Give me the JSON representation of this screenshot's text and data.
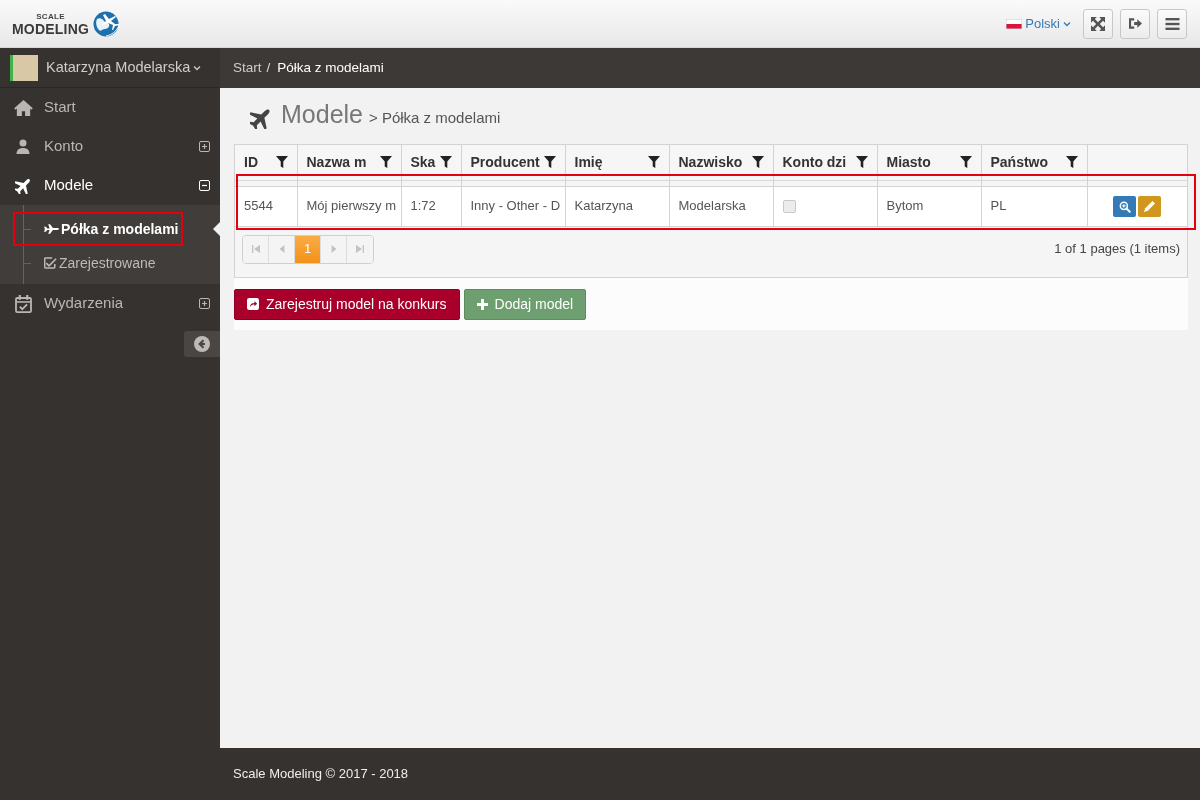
{
  "topbar": {
    "logo": {
      "small": "SCALE",
      "main": "MODELING"
    },
    "language": {
      "label": "Polski"
    },
    "buttons": [
      {
        "kind": "fullscreen"
      },
      {
        "kind": "logout"
      },
      {
        "kind": "menu"
      }
    ]
  },
  "sidebar": {
    "user": {
      "name": "Katarzyna Modelarska"
    },
    "items": [
      {
        "kind": "link",
        "label": "Start",
        "selected": false
      },
      {
        "kind": "group",
        "label": "Konto",
        "selected": false,
        "expanded": false
      },
      {
        "kind": "group",
        "label": "Modele",
        "selected": true,
        "expanded": true,
        "children": [
          {
            "label": "Półka z modelami",
            "selected": true,
            "highlighted": true
          },
          {
            "label": "Zarejestrowane",
            "selected": false,
            "highlighted": false
          }
        ]
      },
      {
        "kind": "group",
        "label": "Wydarzenia",
        "selected": false,
        "expanded": false
      }
    ]
  },
  "breadcrumb": {
    "items": [
      "Start",
      "Półka z modelami"
    ],
    "separator": "/"
  },
  "page_header": {
    "title": "Modele",
    "subtitle": "> Półka z modelami"
  },
  "table": {
    "columns": [
      "ID",
      "Nazwa m",
      "Ska",
      "Producent",
      "Imię",
      "Nazwisko",
      "Konto dzi",
      "Miasto",
      "Państwo"
    ],
    "rows": [
      {
        "highlighted": true,
        "cells": [
          {
            "kind": "text",
            "text": "5544"
          },
          {
            "kind": "text",
            "text": "Mój pierwszy m"
          },
          {
            "kind": "text",
            "text": "1:72"
          },
          {
            "kind": "text",
            "text": "Inny - Other - D"
          },
          {
            "kind": "text",
            "text": "Katarzyna"
          },
          {
            "kind": "text",
            "text": "Modelarska"
          },
          {
            "kind": "checkbox",
            "checked": false,
            "disabled": true
          },
          {
            "kind": "text",
            "text": "Bytom"
          },
          {
            "kind": "text",
            "text": "PL"
          },
          {
            "kind": "actions",
            "buttons": [
              {
                "kind": "view"
              },
              {
                "kind": "edit"
              }
            ]
          }
        ]
      }
    ]
  },
  "pager": {
    "nav": [
      {
        "kind": "first",
        "disabled": true
      },
      {
        "kind": "prev",
        "disabled": true
      },
      {
        "kind": "next",
        "disabled": true
      },
      {
        "kind": "last",
        "disabled": true
      }
    ],
    "pages": [
      {
        "label": "1",
        "selected": true
      }
    ],
    "summary": "1 of 1 pages (1 items)"
  },
  "actions": [
    {
      "kind": "register",
      "label": "Zarejestruj model na konkurs"
    },
    {
      "kind": "add",
      "label": "Dodaj model"
    }
  ],
  "footer": {
    "text": "Scale Modeling © 2017 - 2018"
  }
}
